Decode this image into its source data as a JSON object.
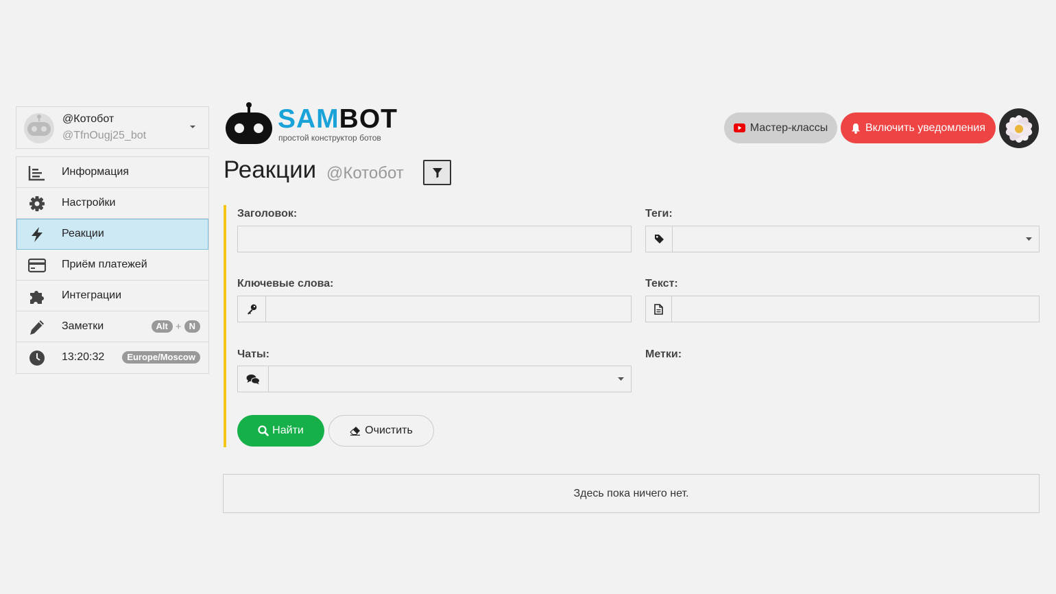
{
  "bot": {
    "name": "@Котобот",
    "username": "@TfnOugj25_bot"
  },
  "sidebar": {
    "items": [
      {
        "label": "Информация",
        "icon": "chart-bar-icon"
      },
      {
        "label": "Настройки",
        "icon": "gear-icon"
      },
      {
        "label": "Реакции",
        "icon": "bolt-icon",
        "active": true
      },
      {
        "label": "Приём платежей",
        "icon": "credit-card-icon"
      },
      {
        "label": "Интеграции",
        "icon": "puzzle-icon"
      },
      {
        "label": "Заметки",
        "icon": "pencil-icon",
        "shortcut": [
          "Alt",
          "+",
          "N"
        ]
      },
      {
        "label": "13:20:32",
        "icon": "clock-icon",
        "badge": "Europe/Moscow"
      }
    ]
  },
  "header": {
    "logo_main": "SAM",
    "logo_accent": "BOT",
    "logo_sub": "простой конструктор ботов",
    "master_label": "Мастер-классы",
    "notify_label": "Включить уведомления"
  },
  "page": {
    "title": "Реакции",
    "subtitle": "@Котобот"
  },
  "form": {
    "title_label": "Заголовок:",
    "tags_label": "Теги:",
    "keywords_label": "Ключевые слова:",
    "text_label": "Текст:",
    "chats_label": "Чаты:",
    "marks_label": "Метки:",
    "find_label": "Найти",
    "clear_label": "Очистить"
  },
  "results": {
    "empty": "Здесь пока ничего нет."
  },
  "colors": {
    "brand_blue": "#1aa3d8",
    "active_bg": "#cde9f4",
    "accent_yellow": "#f5c518",
    "notify_red": "#ee4444",
    "find_green": "#16b04a"
  }
}
